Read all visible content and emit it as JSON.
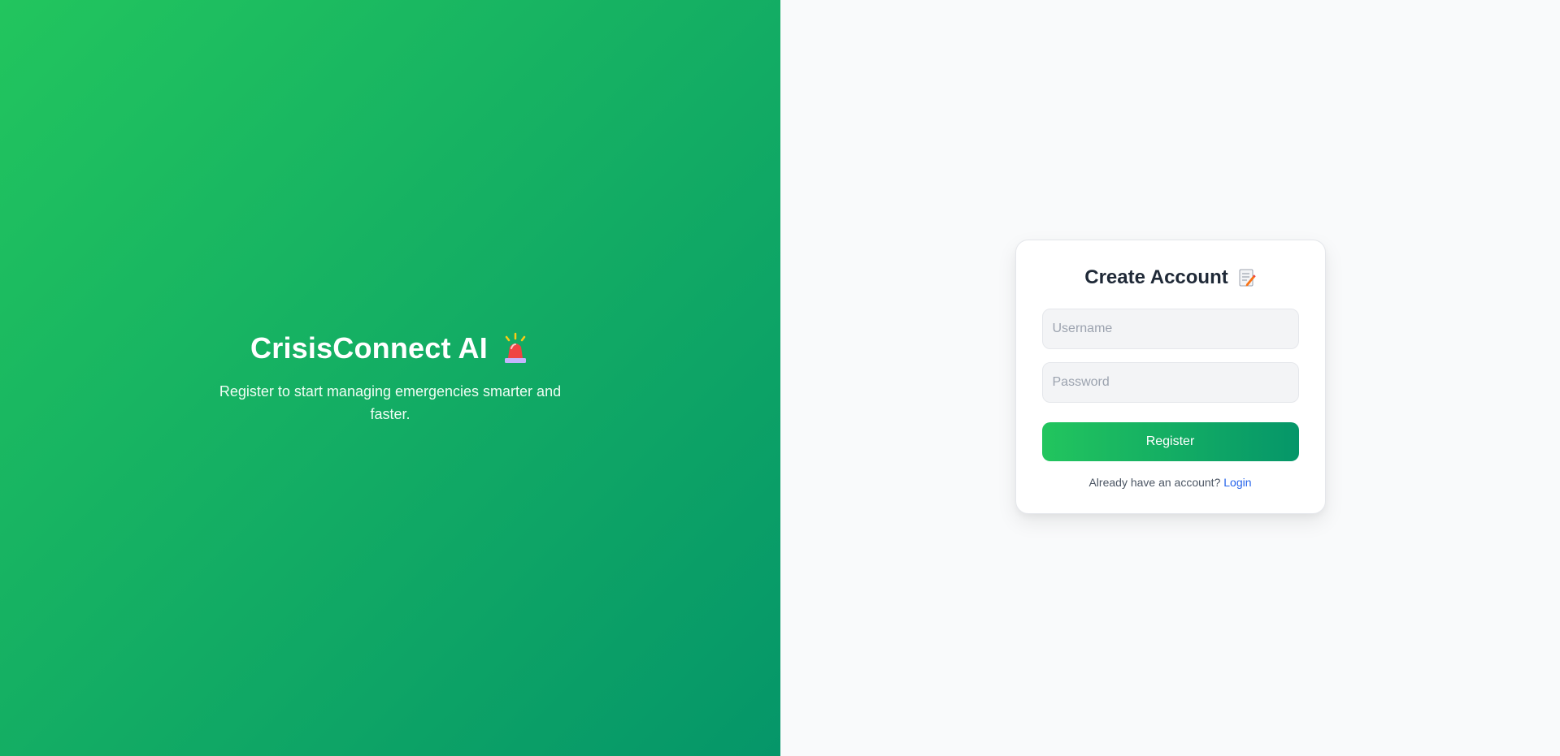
{
  "hero": {
    "title": "CrisisConnect AI",
    "title_icon": "siren-icon",
    "subtitle": "Register to start managing emergencies smarter and faster."
  },
  "form": {
    "title": "Create Account",
    "title_icon": "memo-icon",
    "username": {
      "placeholder": "Username",
      "value": ""
    },
    "password": {
      "placeholder": "Password",
      "value": ""
    },
    "submit_label": "Register",
    "login_prompt": "Already have an account?",
    "login_link": "Login"
  },
  "colors": {
    "brand_start": "#22c55e",
    "brand_end": "#059669",
    "link": "#2563eb"
  }
}
